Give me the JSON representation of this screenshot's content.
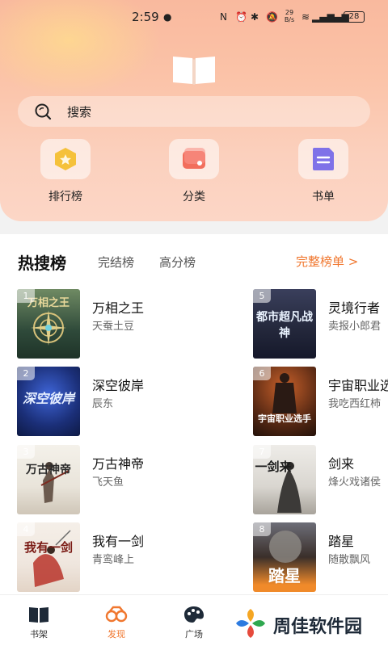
{
  "status_bar": {
    "time": "2:59",
    "net_speed": "29 B/s",
    "battery": "28"
  },
  "search": {
    "placeholder": "搜索"
  },
  "shortcuts": [
    {
      "label": "排行榜",
      "icon": "ranking-icon",
      "color": "#f5c13a"
    },
    {
      "label": "分类",
      "icon": "category-icon",
      "color": "#f26e5c"
    },
    {
      "label": "书单",
      "icon": "booklist-icon",
      "color": "#7f72e8"
    }
  ],
  "ranking": {
    "tabs": [
      "热搜榜",
      "完结榜",
      "高分榜"
    ],
    "full_link": "完整榜单 >",
    "books": [
      {
        "rank": "1",
        "title": "万相之王",
        "author": "天蚕土豆",
        "cover_text": "万相之王",
        "cover_color": "#2f4a3a"
      },
      {
        "rank": "2",
        "title": "深空彼岸",
        "author": "辰东",
        "cover_text": "深空彼岸",
        "cover_color": "#1b2f78"
      },
      {
        "rank": "3",
        "title": "万古神帝",
        "author": "飞天鱼",
        "cover_text": "万古神帝",
        "cover_color": "#e9e4da"
      },
      {
        "rank": "4",
        "title": "我有一剑",
        "author": "青鸾峰上",
        "cover_text": "我有一剑",
        "cover_color": "#efe6de"
      },
      {
        "rank": "5",
        "title": "灵境行者",
        "author": "卖报小郎君",
        "cover_text": "都市超凡战神",
        "cover_color": "#25293d"
      },
      {
        "rank": "6",
        "title": "宇宙职业选手",
        "author": "我吃西红柿",
        "cover_text": "宇宙职业选手",
        "cover_color": "#5a2a14"
      },
      {
        "rank": "7",
        "title": "剑来",
        "author": "烽火戏诸侯",
        "cover_text": "一剑来",
        "cover_color": "#d9d6d0"
      },
      {
        "rank": "8",
        "title": "踏星",
        "author": "随散飘风",
        "cover_text": "踏星",
        "cover_color": "#3a2f2a"
      }
    ]
  },
  "bottom_nav": [
    {
      "label": "书架",
      "icon": "bookshelf-icon"
    },
    {
      "label": "发现",
      "icon": "discover-icon",
      "active": true
    },
    {
      "label": "广场",
      "icon": "square-icon"
    }
  ],
  "watermark": {
    "text": "周佳软件园"
  },
  "accent_color": "#f0772f"
}
